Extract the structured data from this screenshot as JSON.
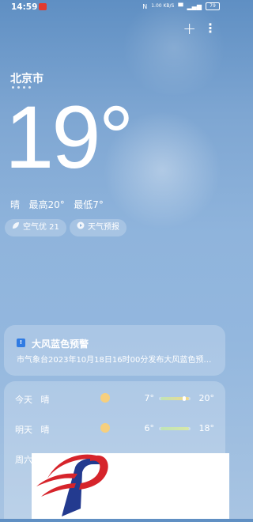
{
  "status_bar": {
    "time": "14:59",
    "speed": "1.00\nKB/S",
    "signal": "4G",
    "battery": "79"
  },
  "header": {
    "add_label": "+",
    "more_label": "⋮"
  },
  "location": {
    "city": "北京市"
  },
  "current": {
    "temperature": "19°",
    "condition": "晴",
    "high_label": "最高20°",
    "low_label": "最低7°"
  },
  "chips": [
    {
      "label": "空气优 21",
      "icon": "leaf-icon"
    },
    {
      "label": "天气预报",
      "icon": "play-circle-icon"
    }
  ],
  "alert": {
    "icon": "warning-badge-icon",
    "title": "大风蓝色预警",
    "text": "市气象台2023年10月18日16时00分发布大风蓝色预…",
    "accent": "#2f7be3"
  },
  "forecast": [
    {
      "day": "今天",
      "condition": "晴",
      "icon": "sun-icon",
      "low": "7°",
      "high": "20°",
      "range": [
        0.05,
        0.95
      ],
      "current": 0.78
    },
    {
      "day": "明天",
      "condition": "晴",
      "icon": "sun-icon",
      "low": "6°",
      "high": "18°",
      "range": [
        0.05,
        0.95
      ]
    },
    {
      "day": "周六",
      "condition": "",
      "icon": "",
      "low": "",
      "high": ""
    }
  ]
}
